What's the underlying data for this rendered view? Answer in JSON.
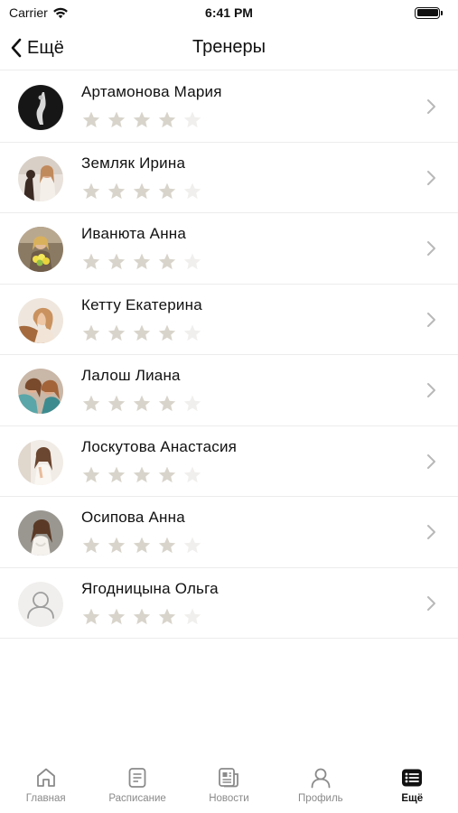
{
  "status_bar": {
    "carrier": "Carrier",
    "time": "6:41 PM"
  },
  "nav": {
    "back_label": "Ещё",
    "title": "Тренеры"
  },
  "trainers": [
    {
      "name": "Артамонова Мария",
      "rating": 4,
      "max_rating": 5
    },
    {
      "name": "Земляк Ирина",
      "rating": 4,
      "max_rating": 5
    },
    {
      "name": "Иванюта Анна",
      "rating": 4,
      "max_rating": 5
    },
    {
      "name": "Кетту Екатерина",
      "rating": 4,
      "max_rating": 5
    },
    {
      "name": "Лалош Лиана",
      "rating": 4,
      "max_rating": 5
    },
    {
      "name": "Лоскутова Анастасия",
      "rating": 4,
      "max_rating": 5
    },
    {
      "name": "Осипова Анна",
      "rating": 4,
      "max_rating": 5
    },
    {
      "name": "Ягодницына Ольга",
      "rating": 4,
      "max_rating": 5
    }
  ],
  "tabs": [
    {
      "label": "Главная",
      "icon": "home-icon",
      "active": false
    },
    {
      "label": "Расписание",
      "icon": "schedule-icon",
      "active": false
    },
    {
      "label": "Новости",
      "icon": "news-icon",
      "active": false
    },
    {
      "label": "Профиль",
      "icon": "profile-icon",
      "active": false
    },
    {
      "label": "Ещё",
      "icon": "more-list-icon",
      "active": true
    }
  ],
  "colors": {
    "star_filled": "#d8d4cb",
    "star_empty": "#f0efed",
    "divider": "#ececec",
    "tab_inactive": "#8a8a8a",
    "tab_active": "#111111"
  }
}
